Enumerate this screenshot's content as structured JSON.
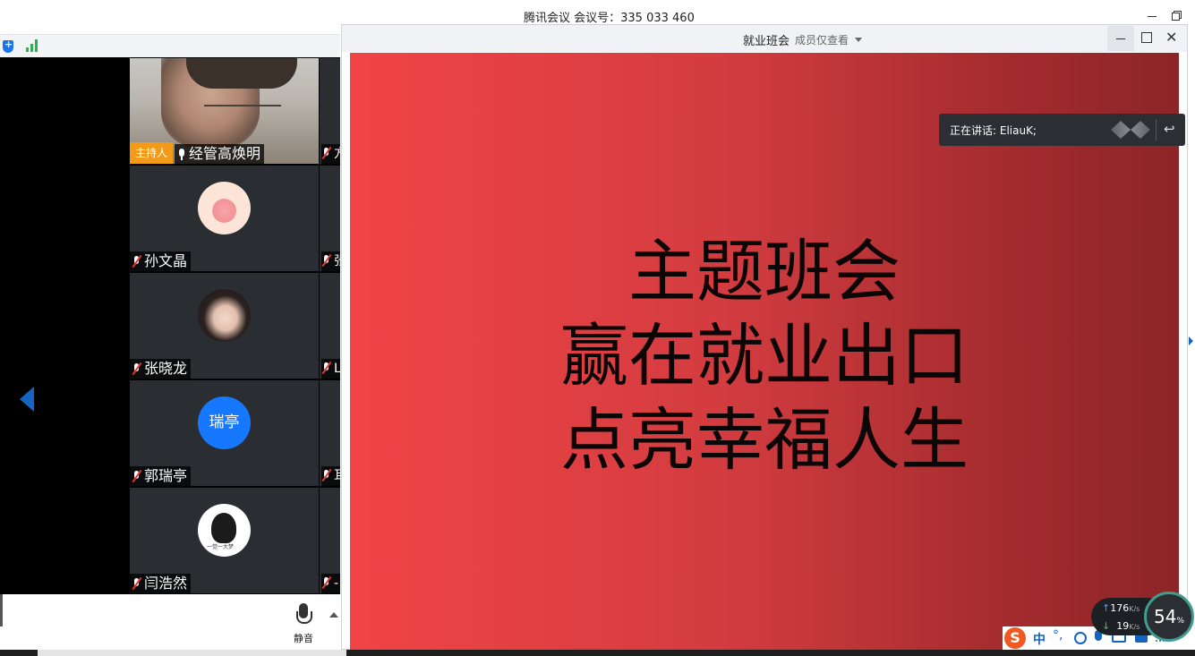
{
  "main_window": {
    "title": "腾讯会议 会议号：335 033 460"
  },
  "gallery": {
    "tiles": [
      {
        "host_badge": "主持人",
        "name": "经管高焕明",
        "muted": false,
        "avatar": "video"
      },
      {
        "name": "孙文晶",
        "muted": true,
        "avatar": "pink-cartoon-avatar"
      },
      {
        "name": "张晓龙",
        "muted": true,
        "avatar": "photo-avatar"
      },
      {
        "name": "郭瑞亭",
        "muted": true,
        "avatar": "text",
        "avatar_text": "瑞亭"
      },
      {
        "name": "闫浩然",
        "muted": true,
        "avatar": "cartoon-avatar",
        "avatar_caption": "一觉一大梦"
      }
    ],
    "partial_column": [
      "方",
      "张",
      "L",
      "耳",
      "-"
    ]
  },
  "bottom_bar": {
    "mute_label": "静音"
  },
  "share_window": {
    "title": "就业班会",
    "view_mode": "成员仅查看",
    "speaking_label": "正在讲话: EliauK;"
  },
  "slide": {
    "lines": [
      "主题班会",
      "赢在就业出口",
      "点亮幸福人生"
    ],
    "gradient": [
      "#f14446",
      "#8c2527"
    ]
  },
  "network": {
    "upload": "176",
    "upload_unit": "K/s",
    "download": "19",
    "download_unit": "K/s",
    "usage_value": "54",
    "usage_unit": "%"
  },
  "ime": {
    "logo": "S",
    "mode": "中",
    "punct": "°,"
  },
  "colors": {
    "host_badge": "#f39b19",
    "accent_blue": "#1677ff",
    "mic_muted": "#e53935"
  }
}
